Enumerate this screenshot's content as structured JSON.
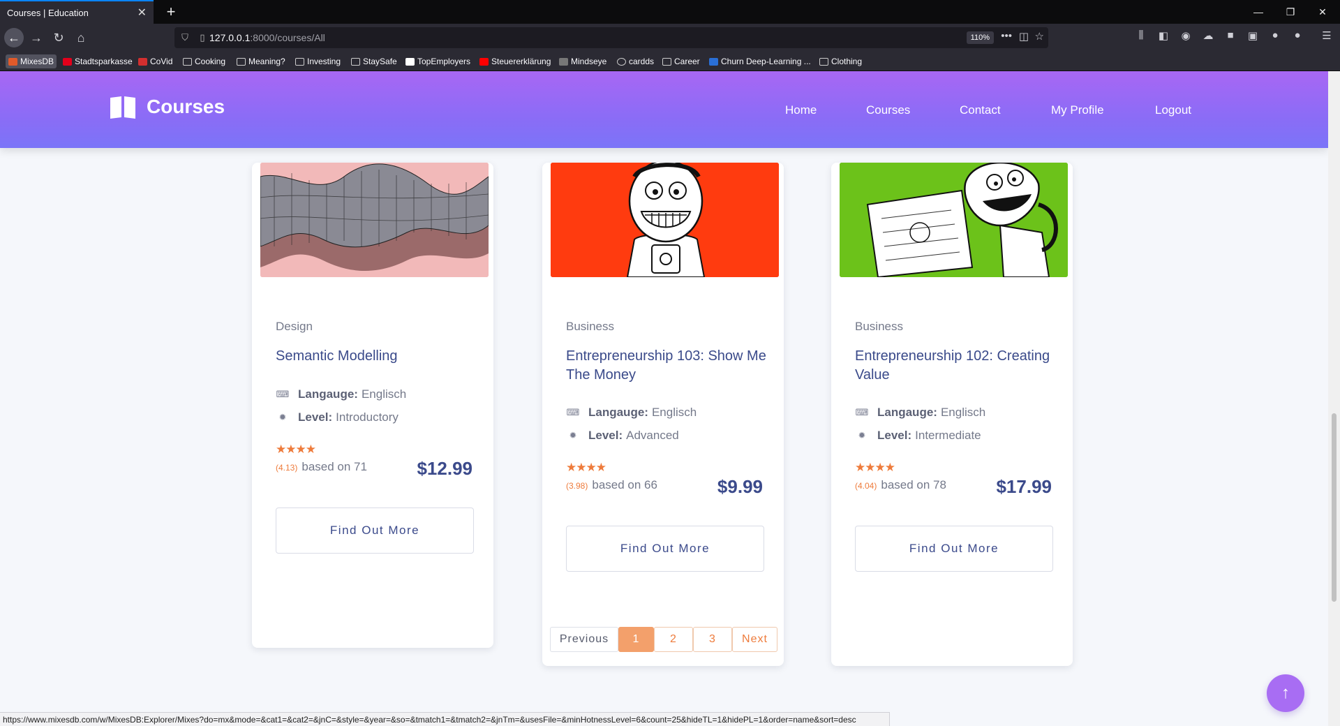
{
  "browser": {
    "tab_title": "Courses | Education",
    "url_host": "127.0.0.1",
    "url_path": ":8000/courses/All",
    "zoom": "110%",
    "bookmarks": [
      {
        "label": "MixesDB",
        "color": "#e05a2a"
      },
      {
        "label": "Stadtsparkasse",
        "color": "#e3001b"
      },
      {
        "label": "CoVid",
        "color": "#d32f2f"
      },
      {
        "label": "Cooking",
        "color": "folder"
      },
      {
        "label": "Meaning?",
        "color": "folder"
      },
      {
        "label": "Investing",
        "color": "folder"
      },
      {
        "label": "StaySafe",
        "color": "folder"
      },
      {
        "label": "TopEmployers",
        "color": "#111111"
      },
      {
        "label": "Steuererklärung",
        "color": "#ff0000"
      },
      {
        "label": "Mindseye",
        "color": "#333333"
      },
      {
        "label": "cardds",
        "color": "globe"
      },
      {
        "label": "Career",
        "color": "folder"
      },
      {
        "label": "Churn Deep-Learning ...",
        "color": "#2a6fd6"
      },
      {
        "label": "Clothing",
        "color": "folder"
      }
    ],
    "status_url": "https://www.mixesdb.com/w/MixesDB:Explorer/Mixes?do=mx&mode=&cat1=&cat2=&jnC=&style=&year=&so=&tmatch1=&tmatch2=&jnTm=&usesFile=&minHotnessLevel=6&count=25&hideTL=1&hidePL=1&order=name&sort=desc"
  },
  "site": {
    "logo_text": "Courses",
    "menu": [
      "Home",
      "Courses",
      "Contact",
      "My Profile",
      "Logout"
    ]
  },
  "labels": {
    "language": "Langauge:",
    "level": "Level:",
    "based_on": "based on",
    "find_out_more": "Find Out More"
  },
  "courses": [
    {
      "category": "Design",
      "title": "Semantic Modelling",
      "language": "Englisch",
      "level": "Introductory",
      "stars": 4,
      "rating": "(4.13)",
      "reviews": "based on 71",
      "price": "$12.99",
      "image_bg": "#f1b5b5"
    },
    {
      "category": "Business",
      "title": "Entrepreneurship 103: Show Me The Money",
      "language": "Englisch",
      "level": "Advanced",
      "stars": 4,
      "rating": "(3.98)",
      "reviews": "based on 66",
      "price": "$9.99",
      "image_bg": "#ff3b0f"
    },
    {
      "category": "Business",
      "title": "Entrepreneurship 102: Creating Value",
      "language": "Englisch",
      "level": "Intermediate",
      "stars": 4,
      "rating": "(4.04)",
      "reviews": "based on 78",
      "price": "$17.99",
      "image_bg": "#6cc21a"
    }
  ],
  "pagination": {
    "previous": "Previous",
    "pages": [
      "1",
      "2",
      "3"
    ],
    "current": "1",
    "next": "Next"
  },
  "colors": {
    "accent_orange": "#ee7b3b",
    "title_blue": "#3b4a8b",
    "header_gradient_top": "#a867f4",
    "header_gradient_bottom": "#7b74f8"
  }
}
